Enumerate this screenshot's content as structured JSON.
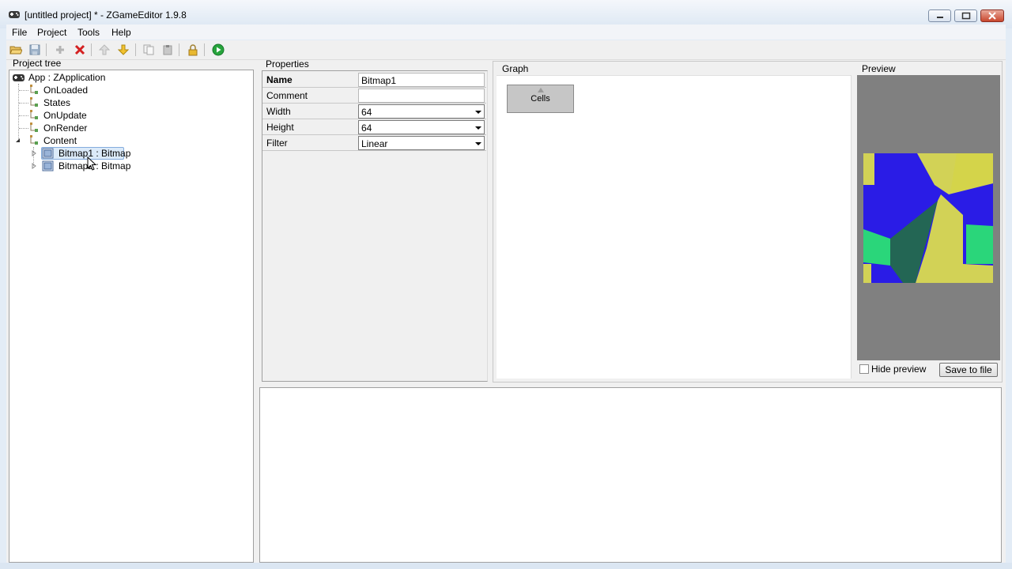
{
  "window": {
    "title": "[untitled project] * - ZGameEditor 1.9.8",
    "icon": "gamepad-icon"
  },
  "menu": [
    "File",
    "Project",
    "Tools",
    "Help"
  ],
  "toolbar": {
    "buttons": [
      "open-folder-icon",
      "save-icon",
      "add-icon",
      "delete-icon",
      "move-up-icon",
      "move-down-icon",
      "copy-icon",
      "paste-icon",
      "lock-icon",
      "run-icon"
    ]
  },
  "project_tree": {
    "label": "Project tree",
    "items": [
      {
        "label": "App : ZApplication",
        "depth": 0
      },
      {
        "label": "OnLoaded",
        "depth": 1
      },
      {
        "label": "States",
        "depth": 1
      },
      {
        "label": "OnUpdate",
        "depth": 1
      },
      {
        "label": "OnRender",
        "depth": 1
      },
      {
        "label": "Content",
        "depth": 1,
        "expanded": true
      },
      {
        "label": "Bitmap1 : Bitmap",
        "depth": 2,
        "selected": true
      },
      {
        "label": "Bitmap2 : Bitmap",
        "depth": 2
      }
    ]
  },
  "properties": {
    "label": "Properties",
    "rows": [
      {
        "name": "Name",
        "value": "Bitmap1",
        "type": "text",
        "bold": true
      },
      {
        "name": "Comment",
        "value": "",
        "type": "text"
      },
      {
        "name": "Width",
        "value": "64",
        "type": "combo"
      },
      {
        "name": "Height",
        "value": "64",
        "type": "combo"
      },
      {
        "name": "Filter",
        "value": "Linear",
        "type": "combo"
      }
    ]
  },
  "graph": {
    "label": "Graph",
    "nodes": [
      {
        "label": "Cells"
      }
    ]
  },
  "preview": {
    "label": "Preview",
    "hide_preview_label": "Hide preview",
    "hide_preview_checked": false,
    "save_button": "Save to file",
    "background_color": "#808080",
    "image_colors": [
      "#d2d256",
      "#2a1ce6",
      "#2ad67a",
      "#236654"
    ]
  }
}
